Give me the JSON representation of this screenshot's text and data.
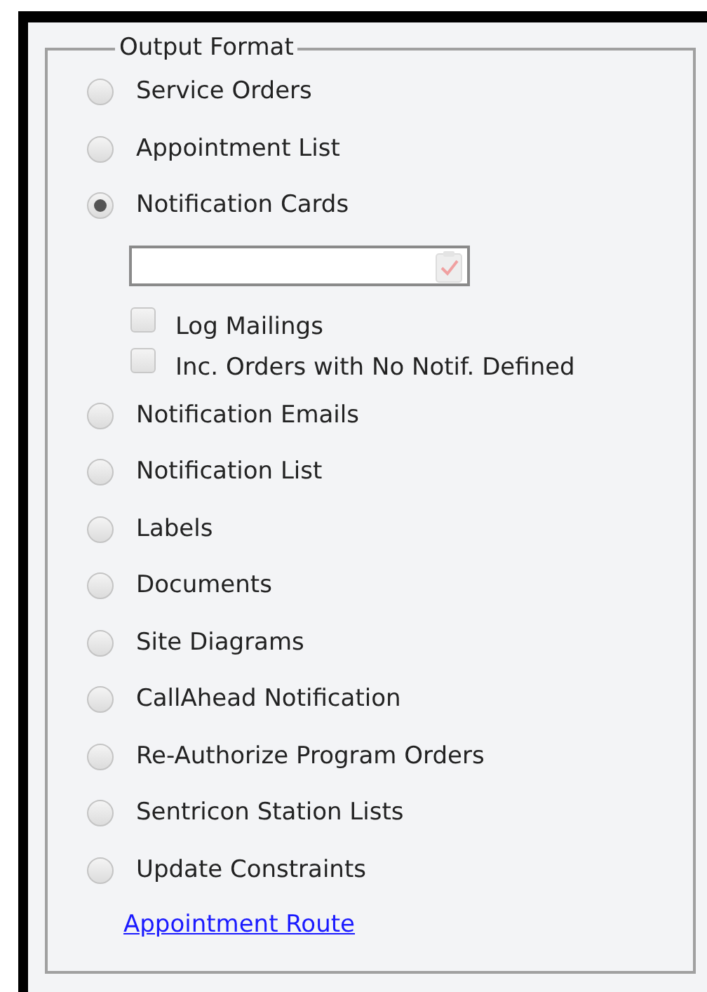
{
  "group": {
    "legend": "Output Format"
  },
  "items": [
    {
      "kind": "radio",
      "label": "Service Orders",
      "selected": false
    },
    {
      "kind": "radio",
      "label": "Appointment List",
      "selected": false
    },
    {
      "kind": "radio",
      "label": "Notification Cards",
      "selected": true
    },
    {
      "kind": "field"
    },
    {
      "kind": "checkbox",
      "label": "Log Mailings",
      "checked": false
    },
    {
      "kind": "checkbox",
      "label": "Inc. Orders with No Notif. Defined",
      "checked": false
    },
    {
      "kind": "radio",
      "label": "Notification Emails",
      "selected": false
    },
    {
      "kind": "radio",
      "label": "Notification List",
      "selected": false
    },
    {
      "kind": "radio",
      "label": "Labels",
      "selected": false
    },
    {
      "kind": "radio",
      "label": "Documents",
      "selected": false
    },
    {
      "kind": "radio",
      "label": "Site Diagrams",
      "selected": false
    },
    {
      "kind": "radio",
      "label": "CallAhead Notification",
      "selected": false
    },
    {
      "kind": "radio",
      "label": "Re-Authorize Program Orders",
      "selected": false
    },
    {
      "kind": "radio",
      "label": "Sentricon Station Lists",
      "selected": false
    },
    {
      "kind": "radio",
      "label": "Update Constraints",
      "selected": false
    },
    {
      "kind": "link",
      "label": "Appointment Route"
    }
  ]
}
